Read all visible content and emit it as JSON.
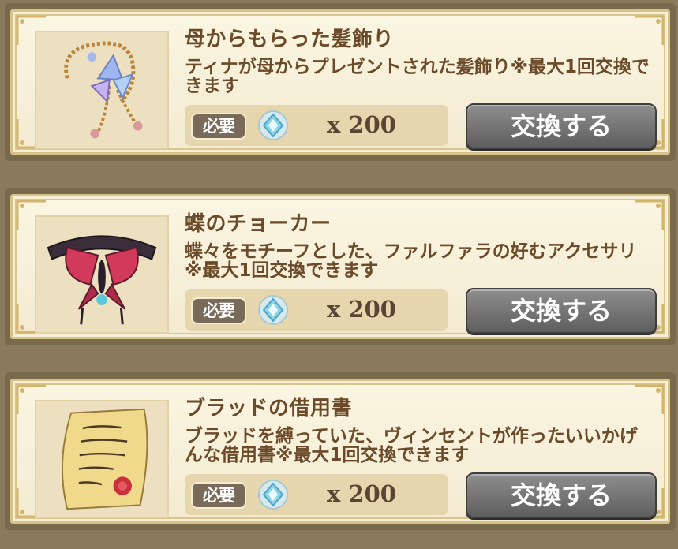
{
  "items": [
    {
      "name": "母からもらった髪飾り",
      "description": "ティナが母からプレゼントされた髪飾り※最大1回交換できます",
      "requirement_label": "必要",
      "cost": "x 200",
      "button_label": "交換する",
      "thumbnail_icon": "hair-ornament-icon"
    },
    {
      "name": "蝶のチョーカー",
      "description": "蝶々をモチーフとした、ファルファラの好むアクセサリ※最大1回交換できます",
      "requirement_label": "必要",
      "cost": "x 200",
      "button_label": "交換する",
      "thumbnail_icon": "butterfly-choker-icon"
    },
    {
      "name": "ブラッドの借用書",
      "description": "ブラッドを縛っていた、ヴィンセントが作ったいいかげんな借用書※最大1回交換できます",
      "requirement_label": "必要",
      "cost": "x 200",
      "button_label": "交換する",
      "thumbnail_icon": "iou-scroll-icon"
    }
  ],
  "currency_icon": "crystal-gem-icon",
  "colors": {
    "card_bg": "#fbf6e2",
    "text_brown": "#6b4a2a",
    "button_gray": "#6e6e6e"
  }
}
